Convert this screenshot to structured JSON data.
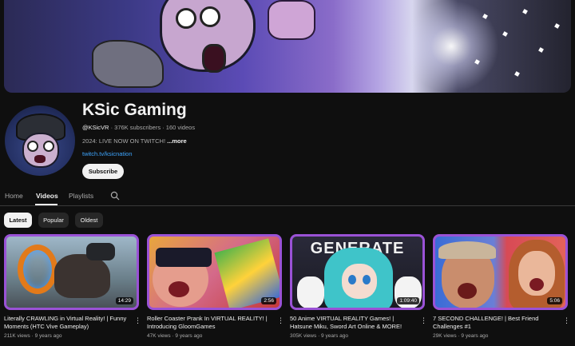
{
  "channel": {
    "name": "KSic Gaming",
    "handle": "@KSicVR",
    "subscribers": "376K subscribers",
    "videos": "160 videos",
    "description": "2024: LIVE NOW ON TWITCH! ",
    "more": "...more",
    "link": "twitch.tv/ksicnation",
    "subscribe_label": "Subscribe"
  },
  "tabs": [
    {
      "label": "Home"
    },
    {
      "label": "Videos"
    },
    {
      "label": "Playlists"
    }
  ],
  "chips": [
    {
      "label": "Latest"
    },
    {
      "label": "Popular"
    },
    {
      "label": "Oldest"
    }
  ],
  "videos": [
    {
      "title": "Literally CRAWLING in Virtual Reality! | Funny Moments (HTC Vive Gameplay)",
      "duration": "14:29",
      "views": "211K views",
      "age": "9 years ago"
    },
    {
      "title": "Roller Coaster Prank In VIRTUAL REALITY! | Introducing GloomGames",
      "duration": "2:56",
      "views": "47K views",
      "age": "9 years ago"
    },
    {
      "title": "50 Anime VIRTUAL REALITY Games! | Hatsune Miku, Sword Art Online & MORE!",
      "duration": "1:09:40",
      "views": "305K views",
      "age": "9 years ago",
      "thumb_text": "GENERATE"
    },
    {
      "title": "7 SECOND CHALLENGE! | Best Friend Challenges #1",
      "duration": "5:06",
      "views": "29K views",
      "age": "9 years ago"
    }
  ],
  "icons": {
    "search": "search-icon",
    "more": "more-vert-icon"
  },
  "colors": {
    "background": "#0f0f0f",
    "thumb_border": "#9a52d6",
    "link": "#3ea6ff"
  }
}
